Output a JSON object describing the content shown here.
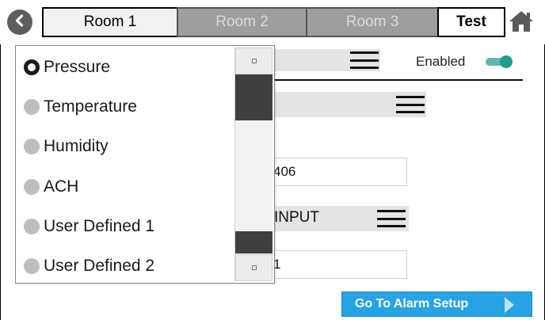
{
  "tabs": [
    {
      "label": "Room 1",
      "state": "active"
    },
    {
      "label": "Room 2",
      "state": "inactive"
    },
    {
      "label": "Room 3",
      "state": "inactive"
    },
    {
      "label": "Test",
      "state": "test"
    }
  ],
  "icons": {
    "back": "back-arrow-icon",
    "home": "home-icon",
    "menu": "hamburger-menu-icon",
    "scroll_up": "scroll-up-icon",
    "scroll_down": "scroll-down-icon"
  },
  "settings": {
    "enabled_label": "Enabled",
    "enabled_on": true,
    "field_value_1": "406",
    "input_dropdown_value": "INPUT",
    "field_value_2": "1"
  },
  "popup": {
    "selected": "Pressure",
    "options": [
      "Pressure",
      "Temperature",
      "Humidity",
      "ACH",
      "User Defined 1",
      "User Defined 2"
    ]
  },
  "footer": {
    "alarm_button_label": "Go To Alarm Setup"
  },
  "colors": {
    "accent_button": "#27a3e5",
    "toggle_on": "#239c8e",
    "inactive_tab": "#9e9e9e",
    "scroll_thumb": "#3f3f3f"
  }
}
